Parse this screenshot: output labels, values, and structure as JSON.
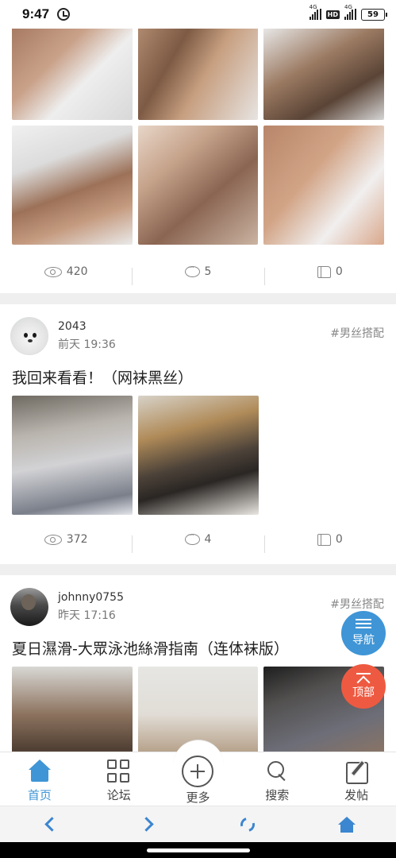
{
  "status_bar": {
    "time": "9:47",
    "network_1": "4G",
    "hd": "HD",
    "network_2": "4G",
    "battery": "59"
  },
  "posts": [
    {
      "views": "420",
      "comments": "5",
      "likes": "0"
    },
    {
      "username": "2043",
      "time": "前天 19:36",
      "tag": "#男丝搭配",
      "title": "我回来看看！（网袜黑丝）",
      "views": "372",
      "comments": "4",
      "likes": "0"
    },
    {
      "username": "johnny0755",
      "time": "昨天 17:16",
      "tag": "#男丝搭配",
      "title": "夏日濕滑-大眾泳池絲滑指南（连体袜版）"
    }
  ],
  "floating": {
    "nav_label": "导航",
    "top_label": "顶部"
  },
  "tabbar": {
    "home": "首页",
    "forum": "论坛",
    "more": "更多",
    "search": "搜索",
    "post": "发帖"
  },
  "colors": {
    "accent": "#3f95d6",
    "top_button": "#ee5a41",
    "browser_icon": "#3b86d0"
  }
}
